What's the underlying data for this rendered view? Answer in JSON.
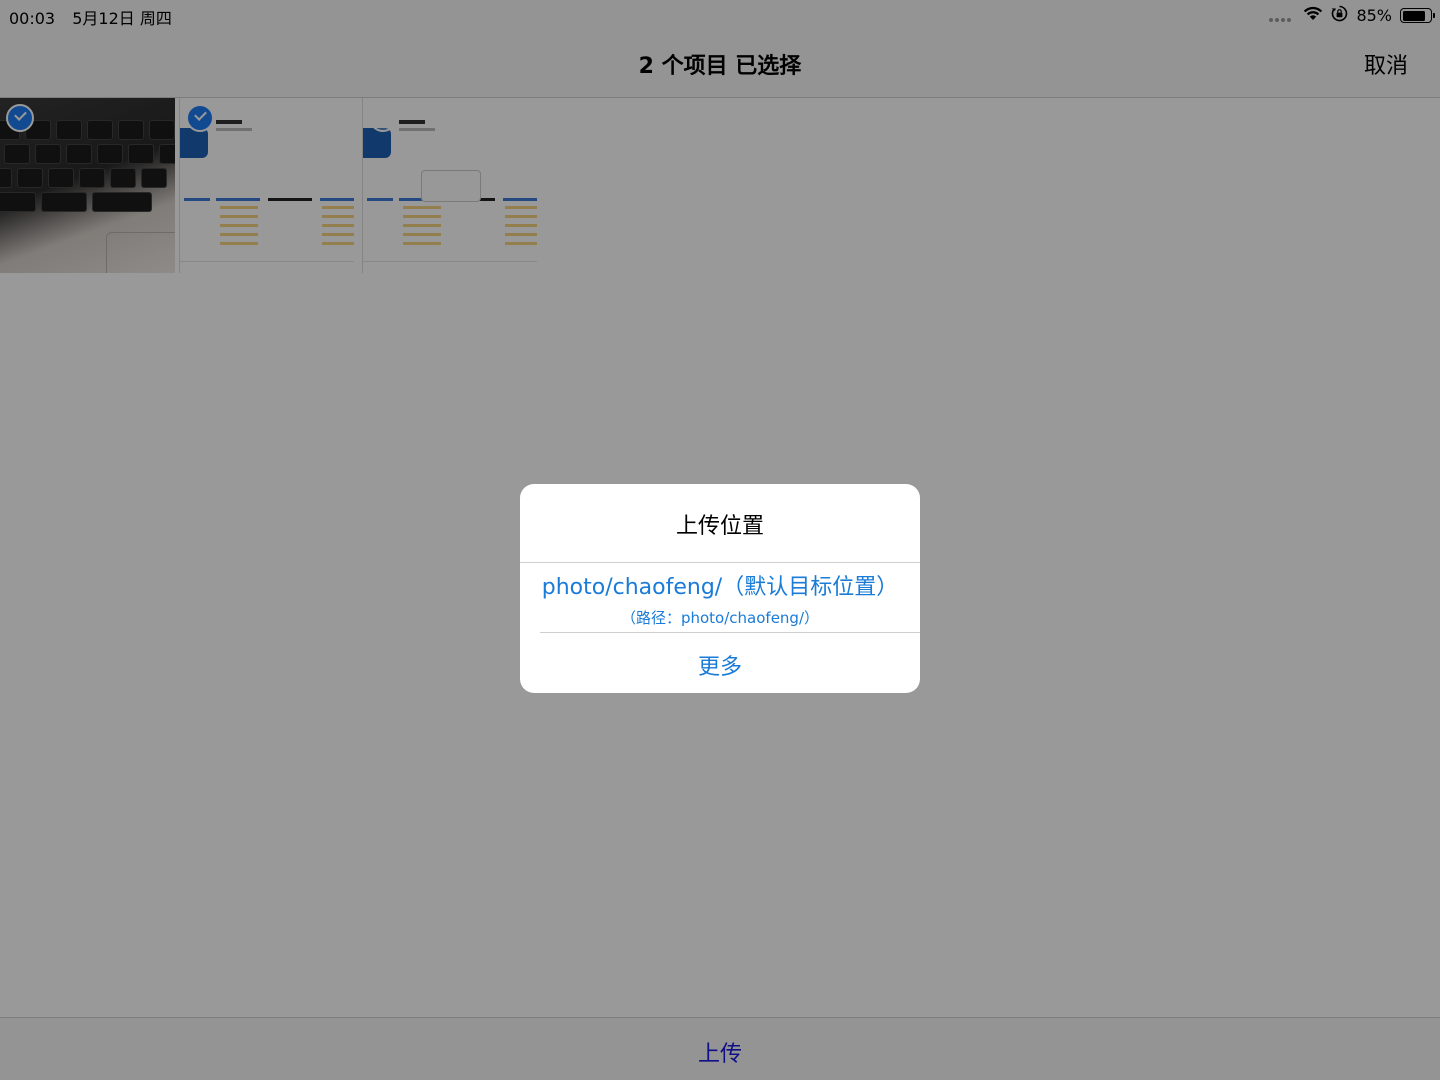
{
  "status_bar": {
    "time": "00:03",
    "date": "5月12日 周四",
    "battery_percent": "85%",
    "battery_level": 0.85,
    "icons": [
      "signal-dots-icon",
      "wifi-icon",
      "orientation-lock-icon",
      "battery-icon"
    ]
  },
  "nav": {
    "title": "2 个项目 已选择",
    "cancel_label": "取消"
  },
  "photos": [
    {
      "name": "keyboard-photo",
      "selected": true
    },
    {
      "name": "app-screenshot-1",
      "selected": true
    },
    {
      "name": "app-screenshot-2",
      "selected": false
    }
  ],
  "alert": {
    "title": "上传位置",
    "option_main": "photo/chaofeng/（默认目标位置）",
    "option_sub": "（路径：photo/chaofeng/）",
    "more_label": "更多"
  },
  "toolbar": {
    "upload_label": "上传"
  },
  "colors": {
    "accent": "#1a7bd8",
    "toolbar_tint": "#1a1ae0",
    "check": "#1d7cf2",
    "dim_overlay": "rgba(0,0,0,0.4)"
  }
}
